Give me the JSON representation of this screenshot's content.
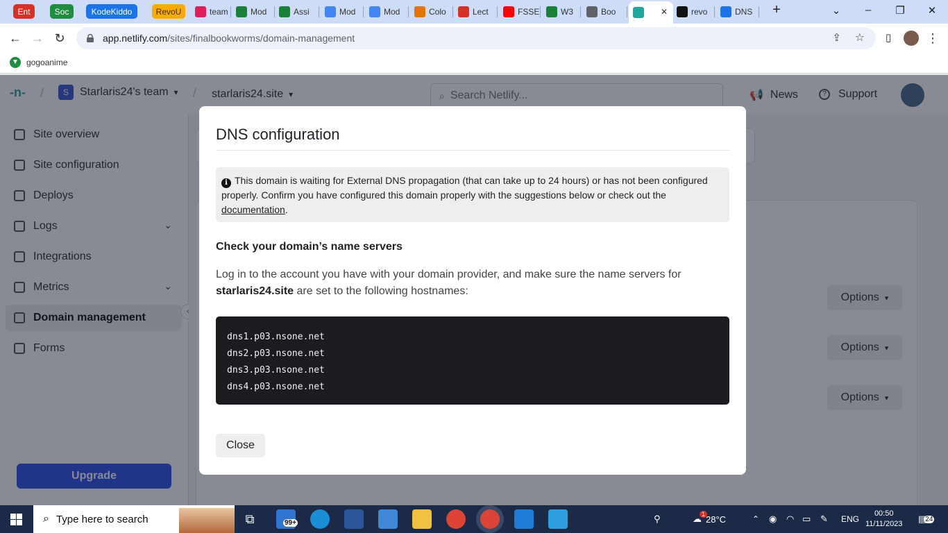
{
  "browser": {
    "group_chips": [
      {
        "label": "Ent",
        "color": "#d93025"
      },
      {
        "label": "Soc",
        "color": "#1e8e3e"
      },
      {
        "label": "KodeKiddo",
        "color": "#1a73e8"
      },
      {
        "label": "RevoU",
        "color": "#f9ab00"
      }
    ],
    "tabs": [
      {
        "label": "team",
        "icon": "slack-icon",
        "color": "#e01e5a"
      },
      {
        "label": "Mod",
        "icon": "drive-icon",
        "color": "#188038"
      },
      {
        "label": "Assi",
        "icon": "drive-icon",
        "color": "#188038"
      },
      {
        "label": "Mod",
        "icon": "docs-icon",
        "color": "#4285f4"
      },
      {
        "label": "Mod",
        "icon": "docs-icon",
        "color": "#4285f4"
      },
      {
        "label": "Colo",
        "icon": "colab-icon",
        "color": "#e37400"
      },
      {
        "label": "Lect",
        "icon": "loading-icon",
        "color": "#d93025"
      },
      {
        "label": "FSSE",
        "icon": "youtube-icon",
        "color": "#ff0000"
      },
      {
        "label": "W3",
        "icon": "drive-icon",
        "color": "#188038"
      },
      {
        "label": "Boo",
        "icon": "globe-icon",
        "color": "#5f6368"
      },
      {
        "label": "",
        "icon": "netlify-icon",
        "color": "#20a7a0"
      },
      {
        "label": "revo",
        "icon": "github-icon",
        "color": "#111111"
      },
      {
        "label": "DNS",
        "icon": "dns-icon",
        "color": "#1a73e8"
      }
    ],
    "url_host": "app.netlify.com",
    "url_path": "/sites/finalbookworms/domain-management",
    "bookmark": "gogoanime"
  },
  "app": {
    "team_initial": "S",
    "team_name": "Starlaris24's team",
    "site_name": "starlaris24.site",
    "search_placeholder": "Search Netlify...",
    "news": "News",
    "support": "Support",
    "sidebar": [
      {
        "label": "Site overview",
        "icon": "overview-icon",
        "chevron": false,
        "active": false
      },
      {
        "label": "Site configuration",
        "icon": "config-icon",
        "chevron": false,
        "active": false
      },
      {
        "label": "Deploys",
        "icon": "deploys-icon",
        "chevron": false,
        "active": false
      },
      {
        "label": "Logs",
        "icon": "logs-icon",
        "chevron": true,
        "active": false
      },
      {
        "label": "Integrations",
        "icon": "integrations-icon",
        "chevron": false,
        "active": false
      },
      {
        "label": "Metrics",
        "icon": "metrics-icon",
        "chevron": true,
        "active": false
      },
      {
        "label": "Domain management",
        "icon": "domain-icon",
        "chevron": false,
        "active": true
      },
      {
        "label": "Forms",
        "icon": "forms-icon",
        "chevron": false,
        "active": false
      }
    ],
    "upgrade": "Upgrade",
    "options_label": "Options"
  },
  "modal": {
    "title": "DNS configuration",
    "notice_pre": "This domain is waiting for External DNS propagation (that can take up to 24 hours) or has not been configured properly. Confirm you have configured this domain properly with the suggestions below or check out the ",
    "notice_link": "documentation",
    "notice_post": ".",
    "heading": "Check your domain’s name servers",
    "para_pre": "Log in to the account you have with your domain provider, and make sure the name servers for ",
    "para_domain": "starlaris24.site",
    "para_post": " are set to the following hostnames:",
    "nameservers": [
      "dns1.p03.nsone.net",
      "dns2.p03.nsone.net",
      "dns3.p03.nsone.net",
      "dns4.p03.nsone.net"
    ],
    "close": "Close"
  },
  "taskbar": {
    "search_placeholder": "Type here to search",
    "mail_badge": "99+",
    "weather_badge": "1",
    "temperature": "28°C",
    "lang": "ENG",
    "time": "00:50",
    "date": "11/11/2023",
    "notif_count": "24"
  }
}
